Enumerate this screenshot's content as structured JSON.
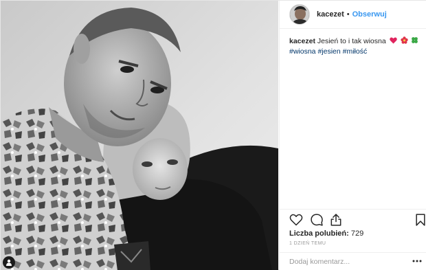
{
  "post": {
    "username": "kacezet",
    "follow_label": "Obserwuj",
    "separator": "•",
    "caption_user": "kacezet",
    "caption_text": "Jesień to i tak wiosna",
    "caption_emojis": [
      "heart-red",
      "flower-red",
      "clover-green"
    ],
    "hashtags": "#wiosna #jesien #miłość",
    "likes_label": "Liczba polubień:",
    "likes_count": "729",
    "time_ago": "1 DZIEŃ TEMU",
    "comment_placeholder": "Dodaj komentarz..."
  },
  "icons": {
    "like": "heart-outline-icon",
    "comment": "comment-bubble-icon",
    "share": "share-upload-icon",
    "save": "bookmark-icon",
    "more": "more-options-icon",
    "tagged": "user-tag-icon"
  },
  "colors": {
    "accent": "#3897f0",
    "hashtag": "#003569",
    "text": "#262626",
    "muted": "#999999"
  }
}
